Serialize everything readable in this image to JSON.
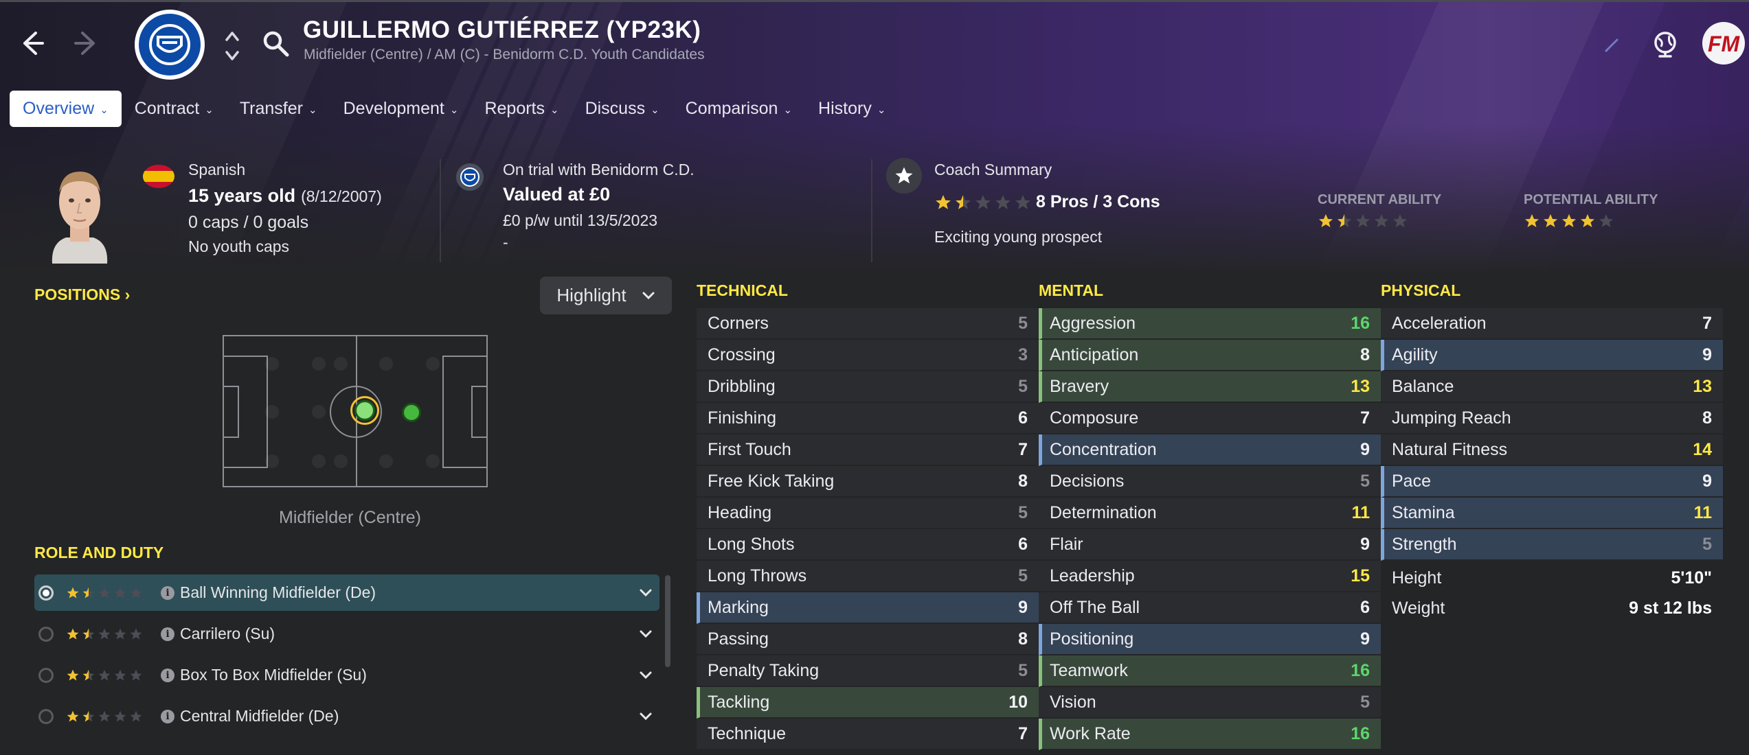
{
  "header": {
    "player_name": "GUILLERMO GUTIÉRREZ (YP23K)",
    "subtitle": "Midfielder (Centre) / AM (C) - Benidorm C.D. Youth Candidates"
  },
  "tabs": [
    {
      "label": "Overview",
      "active": true
    },
    {
      "label": "Contract"
    },
    {
      "label": "Transfer"
    },
    {
      "label": "Development"
    },
    {
      "label": "Reports"
    },
    {
      "label": "Discuss"
    },
    {
      "label": "Comparison"
    },
    {
      "label": "History"
    }
  ],
  "bio": {
    "nationality": "Spanish",
    "age": "15 years old",
    "dob": "(8/12/2007)",
    "caps": "0 caps / 0 goals",
    "youth_caps": "No youth caps"
  },
  "contract": {
    "status": "On trial with Benidorm C.D.",
    "value": "Valued at £0",
    "wage": "£0 p/w until 13/5/2023",
    "extra": "-"
  },
  "coach": {
    "title": "Coach Summary",
    "stars": 1.5,
    "pros_cons": "8 Pros / 3 Cons",
    "summary": "Exciting young prospect"
  },
  "ability": {
    "current_label": "CURRENT ABILITY",
    "current_stars": 1.5,
    "potential_label": "POTENTIAL ABILITY",
    "potential_stars": 4
  },
  "positions": {
    "label": "POSITIONS",
    "highlight_label": "Highlight",
    "position_name": "Midfielder (Centre)"
  },
  "roles": {
    "label": "ROLE AND DUTY",
    "items": [
      {
        "name": "Ball Winning Midfielder (De)",
        "stars": 1.5,
        "selected": true
      },
      {
        "name": "Carrilero (Su)",
        "stars": 1.5
      },
      {
        "name": "Box To Box Midfielder (Su)",
        "stars": 1.5
      },
      {
        "name": "Central Midfielder (De)",
        "stars": 1.5
      }
    ]
  },
  "technical": {
    "label": "TECHNICAL",
    "attrs": [
      {
        "name": "Corners",
        "value": "5",
        "hl": "plain"
      },
      {
        "name": "Crossing",
        "value": "3",
        "hl": "plain"
      },
      {
        "name": "Dribbling",
        "value": "5",
        "hl": "plain"
      },
      {
        "name": "Finishing",
        "value": "6",
        "hl": "plain"
      },
      {
        "name": "First Touch",
        "value": "7",
        "hl": "plain"
      },
      {
        "name": "Free Kick Taking",
        "value": "8",
        "hl": "plain"
      },
      {
        "name": "Heading",
        "value": "5",
        "hl": "plain"
      },
      {
        "name": "Long Shots",
        "value": "6",
        "hl": "plain"
      },
      {
        "name": "Long Throws",
        "value": "5",
        "hl": "plain"
      },
      {
        "name": "Marking",
        "value": "9",
        "hl": "blue"
      },
      {
        "name": "Passing",
        "value": "8",
        "hl": "plain"
      },
      {
        "name": "Penalty Taking",
        "value": "5",
        "hl": "plain"
      },
      {
        "name": "Tackling",
        "value": "10",
        "hl": "green"
      },
      {
        "name": "Technique",
        "value": "7",
        "hl": "plain"
      }
    ]
  },
  "mental": {
    "label": "MENTAL",
    "attrs": [
      {
        "name": "Aggression",
        "value": "16",
        "hl": "green"
      },
      {
        "name": "Anticipation",
        "value": "8",
        "hl": "green"
      },
      {
        "name": "Bravery",
        "value": "13",
        "hl": "green"
      },
      {
        "name": "Composure",
        "value": "7",
        "hl": "plain"
      },
      {
        "name": "Concentration",
        "value": "9",
        "hl": "blue"
      },
      {
        "name": "Decisions",
        "value": "5",
        "hl": "plain"
      },
      {
        "name": "Determination",
        "value": "11",
        "hl": "plain"
      },
      {
        "name": "Flair",
        "value": "9",
        "hl": "plain"
      },
      {
        "name": "Leadership",
        "value": "15",
        "hl": "plain"
      },
      {
        "name": "Off The Ball",
        "value": "6",
        "hl": "plain"
      },
      {
        "name": "Positioning",
        "value": "9",
        "hl": "blue"
      },
      {
        "name": "Teamwork",
        "value": "16",
        "hl": "green"
      },
      {
        "name": "Vision",
        "value": "5",
        "hl": "plain"
      },
      {
        "name": "Work Rate",
        "value": "16",
        "hl": "green"
      }
    ]
  },
  "physical": {
    "label": "PHYSICAL",
    "attrs": [
      {
        "name": "Acceleration",
        "value": "7",
        "hl": "plain"
      },
      {
        "name": "Agility",
        "value": "9",
        "hl": "blue"
      },
      {
        "name": "Balance",
        "value": "13",
        "hl": "plain"
      },
      {
        "name": "Jumping Reach",
        "value": "8",
        "hl": "plain"
      },
      {
        "name": "Natural Fitness",
        "value": "14",
        "hl": "plain"
      },
      {
        "name": "Pace",
        "value": "9",
        "hl": "blue"
      },
      {
        "name": "Stamina",
        "value": "11",
        "hl": "blue"
      },
      {
        "name": "Strength",
        "value": "5",
        "hl": "blue"
      }
    ],
    "height_label": "Height",
    "height": "5'10\"",
    "weight_label": "Weight",
    "weight": "9 st 12 lbs"
  },
  "colors": {
    "accent_yellow": "#ffe945",
    "value_green": "#5ed66b",
    "tab_active_text": "#2a5fc4"
  }
}
